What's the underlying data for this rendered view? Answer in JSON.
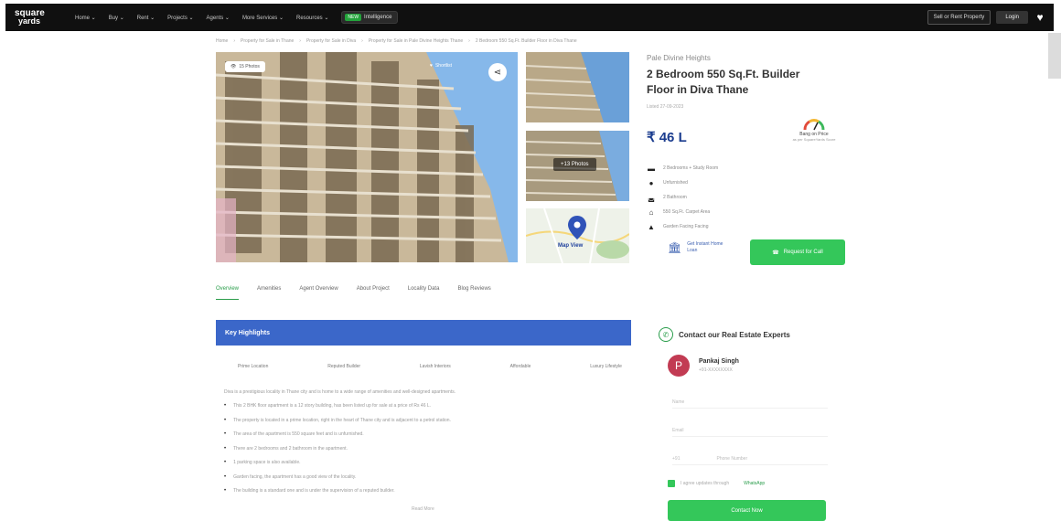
{
  "nav": {
    "logo_line1": "square",
    "logo_line2": "yards",
    "items": [
      "Home",
      "Buy",
      "Rent",
      "Projects",
      "Agents",
      "More Services",
      "Resources"
    ],
    "intel_badge": "NEW",
    "intel_label": "Intelligence",
    "sell_label": "Sell or Rent Property",
    "login_label": "Login"
  },
  "breadcrumb": [
    "Home",
    "Property for Sale in Thane",
    "Property for Sale in Diva",
    "Property for Sale in Pale Divine Heights Thane",
    "2 Bedroom 550 Sq.Ft. Builder Floor in Diva Thane"
  ],
  "gallery": {
    "photo_count": "15 Photos",
    "shortlist_label": "Shortlist",
    "more_photos": "+13 Photos",
    "map_label": "Map View"
  },
  "property": {
    "project_name": "Pale Divine Heights",
    "title": "2 Bedroom 550 Sq.Ft. Builder Floor in Diva Thane",
    "updated": "Listed 27-09-2023",
    "price": "₹ 46 L",
    "gauge_title": "Bang on Price",
    "gauge_sub": "as per SquareYards Score",
    "specs": [
      "2 Bedrooms + Study Room",
      "Unfurnished",
      "2 Bathroom",
      "550 Sq.Ft. Carpet Area",
      "Garden Facing Facing"
    ],
    "loan_label": "Get Instant Home Loan",
    "call_label": "Request for Call"
  },
  "tabs": [
    "Overview",
    "Amenities",
    "Agent Overview",
    "About Project",
    "Locality Data",
    "Blog Reviews"
  ],
  "highlights": {
    "title": "Key Highlights",
    "chips": [
      "Prime Location",
      "Reputed Builder",
      "Lavish Interiors",
      "Affordable",
      "Luxury Lifestyle"
    ],
    "intro": "Diva is a prestigious locality in Thane city and is home to a wide range of amenities and well-designed apartments.",
    "bullets": [
      "This 2 BHK floor apartment is a 12 story building, has been listed up for sale at a price of Rs 46 L.",
      "The property is located in a prime location, right in the heart of Thane city and is adjacent to a petrol station.",
      "The area of the apartment is 550 square feet and is unfurnished.",
      "There are 2 bedrooms and 2 bathroom in the apartment.",
      "1 parking space is also available.",
      "Garden facing, the apartment has a good view of the locality.",
      "The building is a standard one and is under the supervision of a reputed builder."
    ],
    "read_more": "Read More"
  },
  "contact": {
    "title": "Contact our Real Estate Experts",
    "agent_initial": "P",
    "agent_name": "Pankaj Singh",
    "agent_phone": "+91-XXXXXXXX",
    "name_placeholder": "Name",
    "email_placeholder": "Email",
    "code_placeholder": "+91",
    "phone_placeholder": "Phone Number",
    "consent_label": "I agree updates through",
    "whatsapp_label": "WhatsApp",
    "submit_label": "Contact Now"
  }
}
